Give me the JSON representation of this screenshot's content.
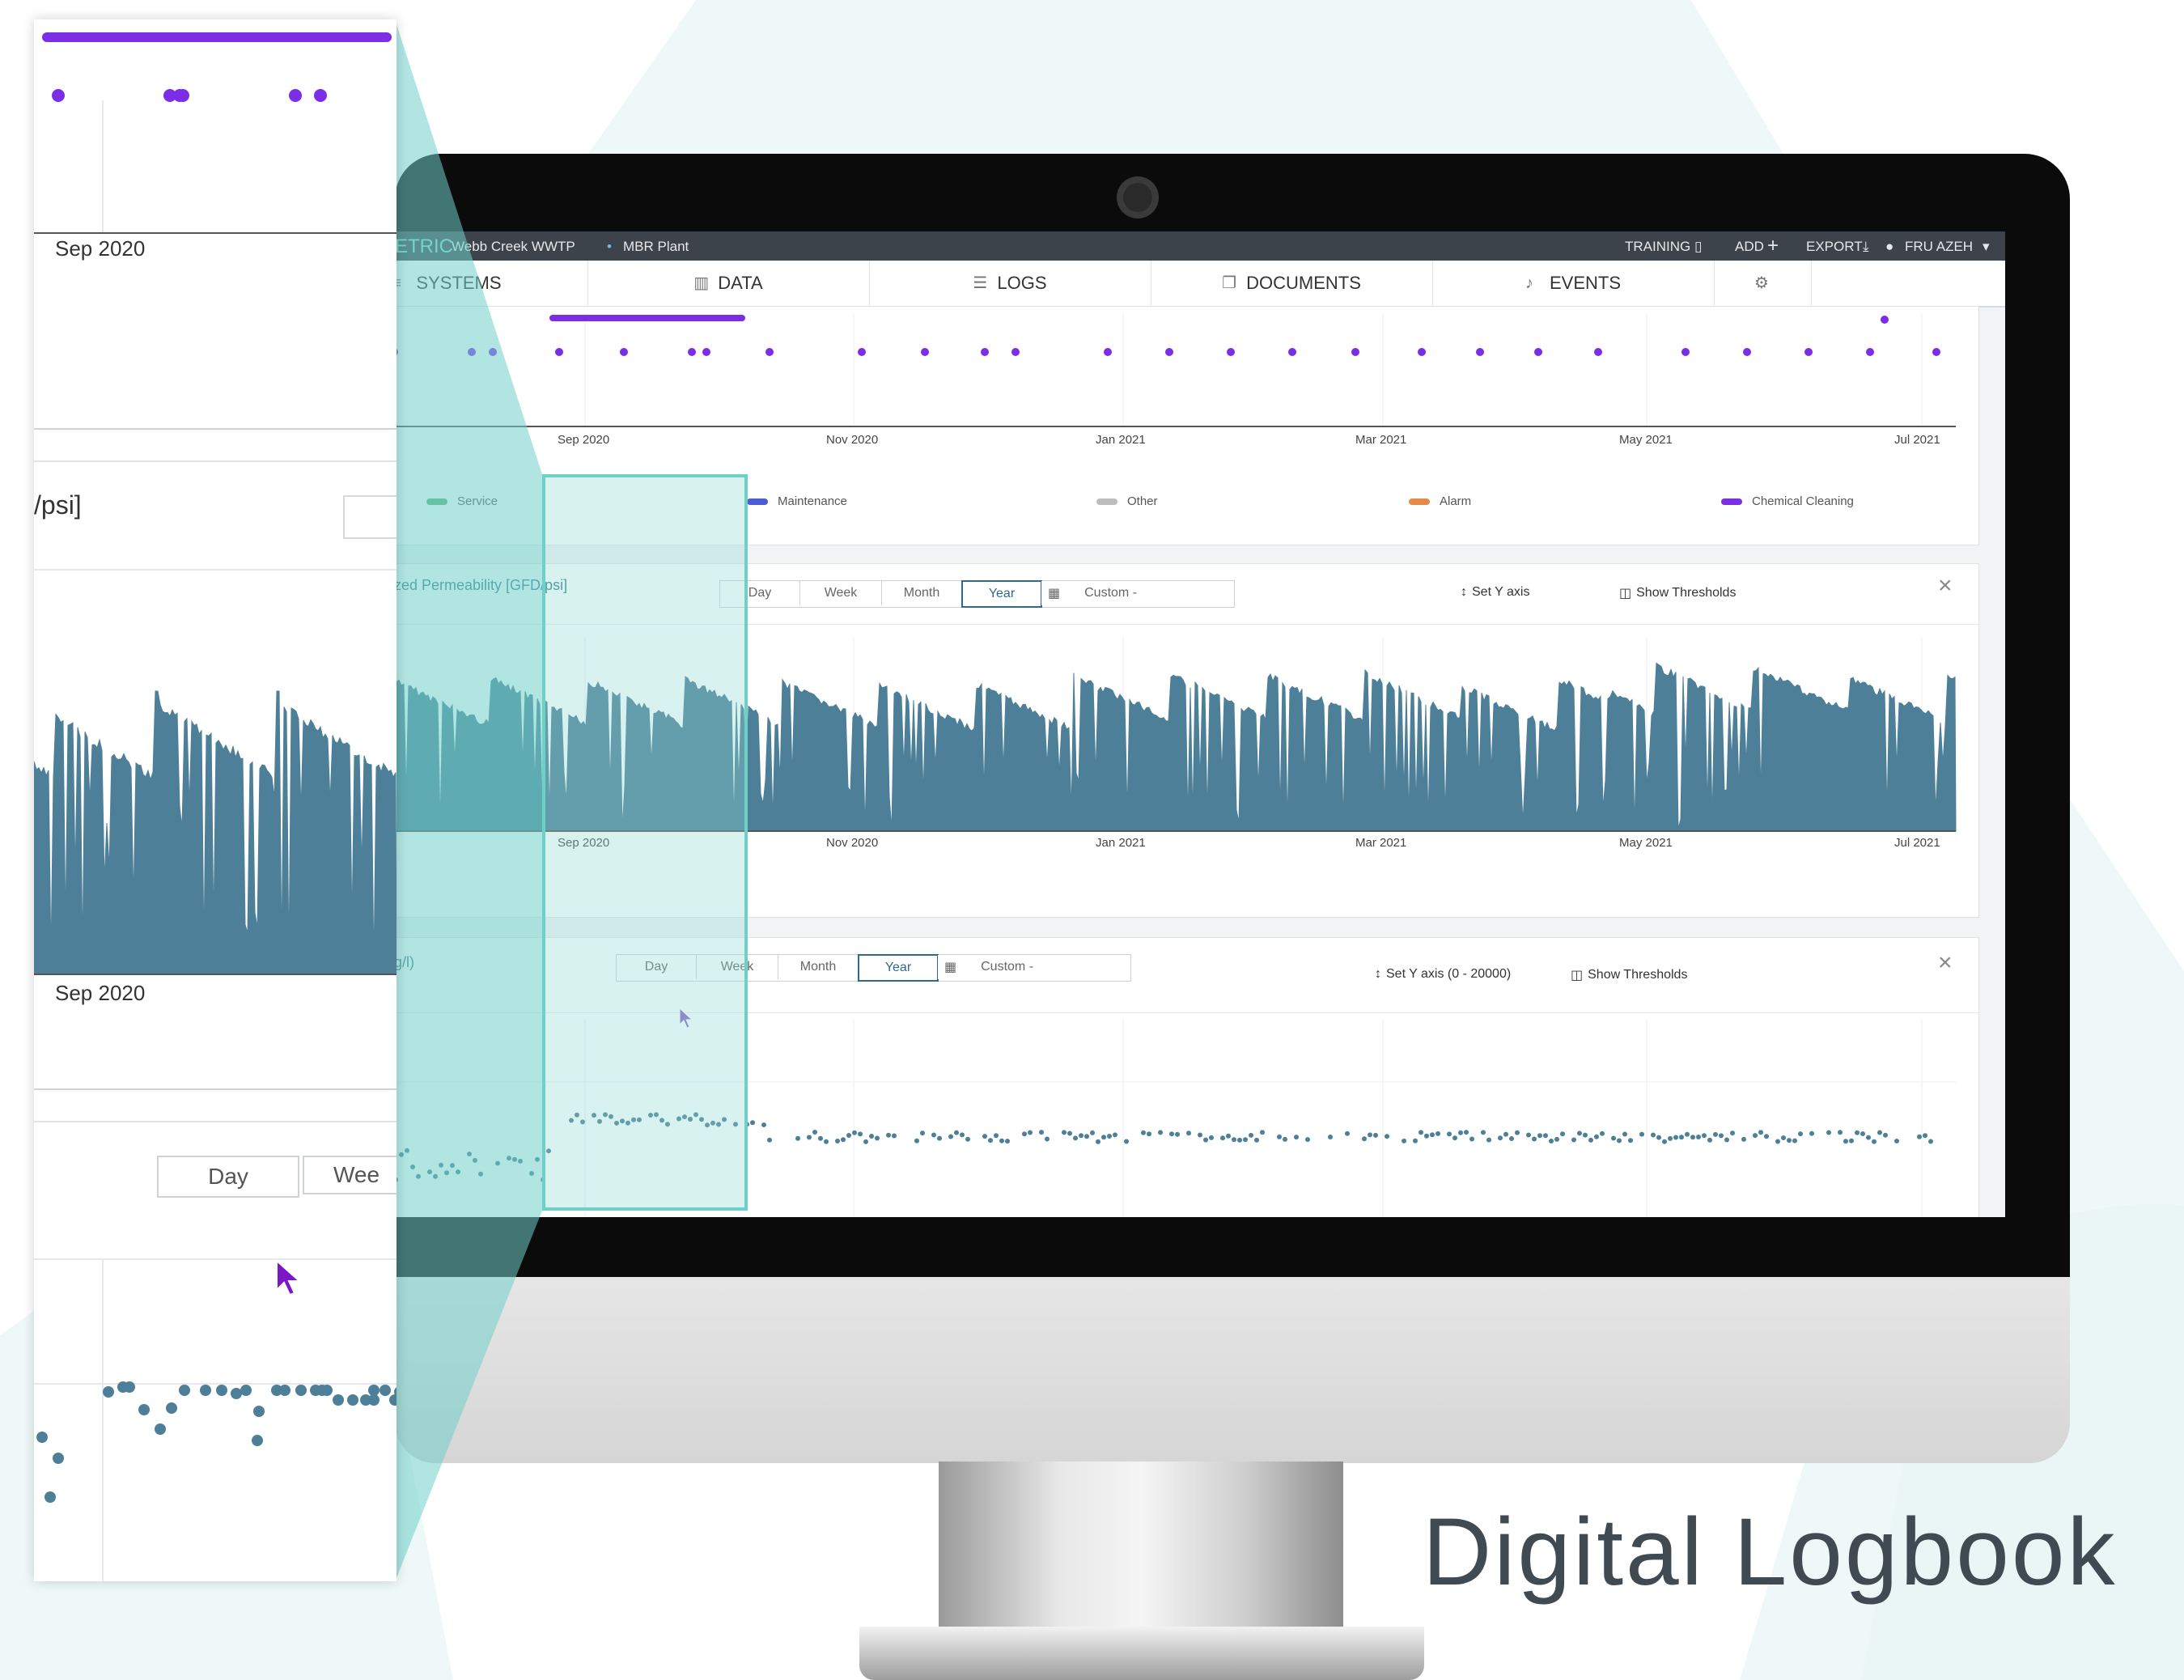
{
  "app": {
    "brand_fragment": "ETRIC",
    "breadcrumb": [
      "Webb Creek WWTP",
      "MBR Plant"
    ],
    "top_actions": {
      "training": "TRAINING",
      "add": "ADD",
      "export": "EXPORT",
      "user": "FRU AZEH"
    }
  },
  "nav": {
    "items": [
      {
        "label": "SYSTEMS",
        "icon": "menu-icon"
      },
      {
        "label": "DATA",
        "icon": "bar-chart-icon"
      },
      {
        "label": "LOGS",
        "icon": "list-icon"
      },
      {
        "label": "DOCUMENTS",
        "icon": "documents-icon"
      },
      {
        "label": "EVENTS",
        "icon": "bell-icon"
      }
    ],
    "settings_icon": "gear-icon"
  },
  "events_chart": {
    "x_ticks": [
      "Sep 2020",
      "Nov 2020",
      "Jan 2021",
      "Mar 2021",
      "May 2021",
      "Jul 2021"
    ],
    "legend": [
      {
        "label": "Service",
        "color": "#5cb377"
      },
      {
        "label": "Maintenance",
        "color": "#4a5bd4"
      },
      {
        "label": "Other",
        "color": "#bdbdbd"
      },
      {
        "label": "Alarm",
        "color": "#e58a4a"
      },
      {
        "label": "Chemical Cleaning",
        "color": "#7b2ee6"
      }
    ]
  },
  "permeability_panel": {
    "title": "zed Permeability [GFD/psi]",
    "ranges": [
      "Day",
      "Week",
      "Month",
      "Year"
    ],
    "active_range": "Year",
    "custom_label": "Custom -",
    "set_y_axis": "Set Y axis",
    "show_thresholds": "Show Thresholds",
    "x_ticks": [
      "Sep 2020",
      "Nov 2020",
      "Jan 2021",
      "Mar 2021",
      "May 2021",
      "Jul 2021"
    ]
  },
  "third_panel": {
    "title": "g/l)",
    "ranges": [
      "Day",
      "Week",
      "Month",
      "Year"
    ],
    "active_range": "Year",
    "custom_label": "Custom -",
    "set_y_axis": "Set Y axis (0 - 20000)",
    "show_thresholds": "Show Thresholds"
  },
  "zoom_inset": {
    "tick_label_1": "Sep 2020",
    "panel_title_fragment": "/psi]",
    "tick_label_2": "Sep 2020",
    "range_day": "Day",
    "range_week_fragment": "Wee"
  },
  "colors": {
    "accent": "#2e6a8e",
    "data_line": "#4d7f98",
    "event_purple": "#7b2ee6",
    "highlight_teal": "#8fd9d3"
  },
  "headline": "Digital Logbook"
}
